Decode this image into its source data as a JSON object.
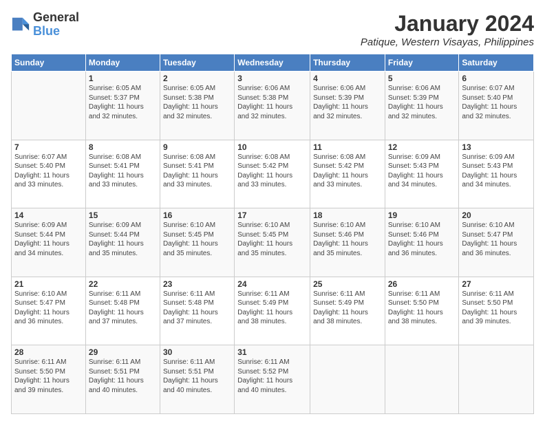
{
  "logo": {
    "line1": "General",
    "line2": "Blue"
  },
  "title": "January 2024",
  "location": "Patique, Western Visayas, Philippines",
  "headers": [
    "Sunday",
    "Monday",
    "Tuesday",
    "Wednesday",
    "Thursday",
    "Friday",
    "Saturday"
  ],
  "weeks": [
    [
      {
        "day": "",
        "info": ""
      },
      {
        "day": "1",
        "info": "Sunrise: 6:05 AM\nSunset: 5:37 PM\nDaylight: 11 hours\nand 32 minutes."
      },
      {
        "day": "2",
        "info": "Sunrise: 6:05 AM\nSunset: 5:38 PM\nDaylight: 11 hours\nand 32 minutes."
      },
      {
        "day": "3",
        "info": "Sunrise: 6:06 AM\nSunset: 5:38 PM\nDaylight: 11 hours\nand 32 minutes."
      },
      {
        "day": "4",
        "info": "Sunrise: 6:06 AM\nSunset: 5:39 PM\nDaylight: 11 hours\nand 32 minutes."
      },
      {
        "day": "5",
        "info": "Sunrise: 6:06 AM\nSunset: 5:39 PM\nDaylight: 11 hours\nand 32 minutes."
      },
      {
        "day": "6",
        "info": "Sunrise: 6:07 AM\nSunset: 5:40 PM\nDaylight: 11 hours\nand 32 minutes."
      }
    ],
    [
      {
        "day": "7",
        "info": "Sunrise: 6:07 AM\nSunset: 5:40 PM\nDaylight: 11 hours\nand 33 minutes."
      },
      {
        "day": "8",
        "info": "Sunrise: 6:08 AM\nSunset: 5:41 PM\nDaylight: 11 hours\nand 33 minutes."
      },
      {
        "day": "9",
        "info": "Sunrise: 6:08 AM\nSunset: 5:41 PM\nDaylight: 11 hours\nand 33 minutes."
      },
      {
        "day": "10",
        "info": "Sunrise: 6:08 AM\nSunset: 5:42 PM\nDaylight: 11 hours\nand 33 minutes."
      },
      {
        "day": "11",
        "info": "Sunrise: 6:08 AM\nSunset: 5:42 PM\nDaylight: 11 hours\nand 33 minutes."
      },
      {
        "day": "12",
        "info": "Sunrise: 6:09 AM\nSunset: 5:43 PM\nDaylight: 11 hours\nand 34 minutes."
      },
      {
        "day": "13",
        "info": "Sunrise: 6:09 AM\nSunset: 5:43 PM\nDaylight: 11 hours\nand 34 minutes."
      }
    ],
    [
      {
        "day": "14",
        "info": "Sunrise: 6:09 AM\nSunset: 5:44 PM\nDaylight: 11 hours\nand 34 minutes."
      },
      {
        "day": "15",
        "info": "Sunrise: 6:09 AM\nSunset: 5:44 PM\nDaylight: 11 hours\nand 35 minutes."
      },
      {
        "day": "16",
        "info": "Sunrise: 6:10 AM\nSunset: 5:45 PM\nDaylight: 11 hours\nand 35 minutes."
      },
      {
        "day": "17",
        "info": "Sunrise: 6:10 AM\nSunset: 5:45 PM\nDaylight: 11 hours\nand 35 minutes."
      },
      {
        "day": "18",
        "info": "Sunrise: 6:10 AM\nSunset: 5:46 PM\nDaylight: 11 hours\nand 35 minutes."
      },
      {
        "day": "19",
        "info": "Sunrise: 6:10 AM\nSunset: 5:46 PM\nDaylight: 11 hours\nand 36 minutes."
      },
      {
        "day": "20",
        "info": "Sunrise: 6:10 AM\nSunset: 5:47 PM\nDaylight: 11 hours\nand 36 minutes."
      }
    ],
    [
      {
        "day": "21",
        "info": "Sunrise: 6:10 AM\nSunset: 5:47 PM\nDaylight: 11 hours\nand 36 minutes."
      },
      {
        "day": "22",
        "info": "Sunrise: 6:11 AM\nSunset: 5:48 PM\nDaylight: 11 hours\nand 37 minutes."
      },
      {
        "day": "23",
        "info": "Sunrise: 6:11 AM\nSunset: 5:48 PM\nDaylight: 11 hours\nand 37 minutes."
      },
      {
        "day": "24",
        "info": "Sunrise: 6:11 AM\nSunset: 5:49 PM\nDaylight: 11 hours\nand 38 minutes."
      },
      {
        "day": "25",
        "info": "Sunrise: 6:11 AM\nSunset: 5:49 PM\nDaylight: 11 hours\nand 38 minutes."
      },
      {
        "day": "26",
        "info": "Sunrise: 6:11 AM\nSunset: 5:50 PM\nDaylight: 11 hours\nand 38 minutes."
      },
      {
        "day": "27",
        "info": "Sunrise: 6:11 AM\nSunset: 5:50 PM\nDaylight: 11 hours\nand 39 minutes."
      }
    ],
    [
      {
        "day": "28",
        "info": "Sunrise: 6:11 AM\nSunset: 5:50 PM\nDaylight: 11 hours\nand 39 minutes."
      },
      {
        "day": "29",
        "info": "Sunrise: 6:11 AM\nSunset: 5:51 PM\nDaylight: 11 hours\nand 40 minutes."
      },
      {
        "day": "30",
        "info": "Sunrise: 6:11 AM\nSunset: 5:51 PM\nDaylight: 11 hours\nand 40 minutes."
      },
      {
        "day": "31",
        "info": "Sunrise: 6:11 AM\nSunset: 5:52 PM\nDaylight: 11 hours\nand 40 minutes."
      },
      {
        "day": "",
        "info": ""
      },
      {
        "day": "",
        "info": ""
      },
      {
        "day": "",
        "info": ""
      }
    ]
  ]
}
